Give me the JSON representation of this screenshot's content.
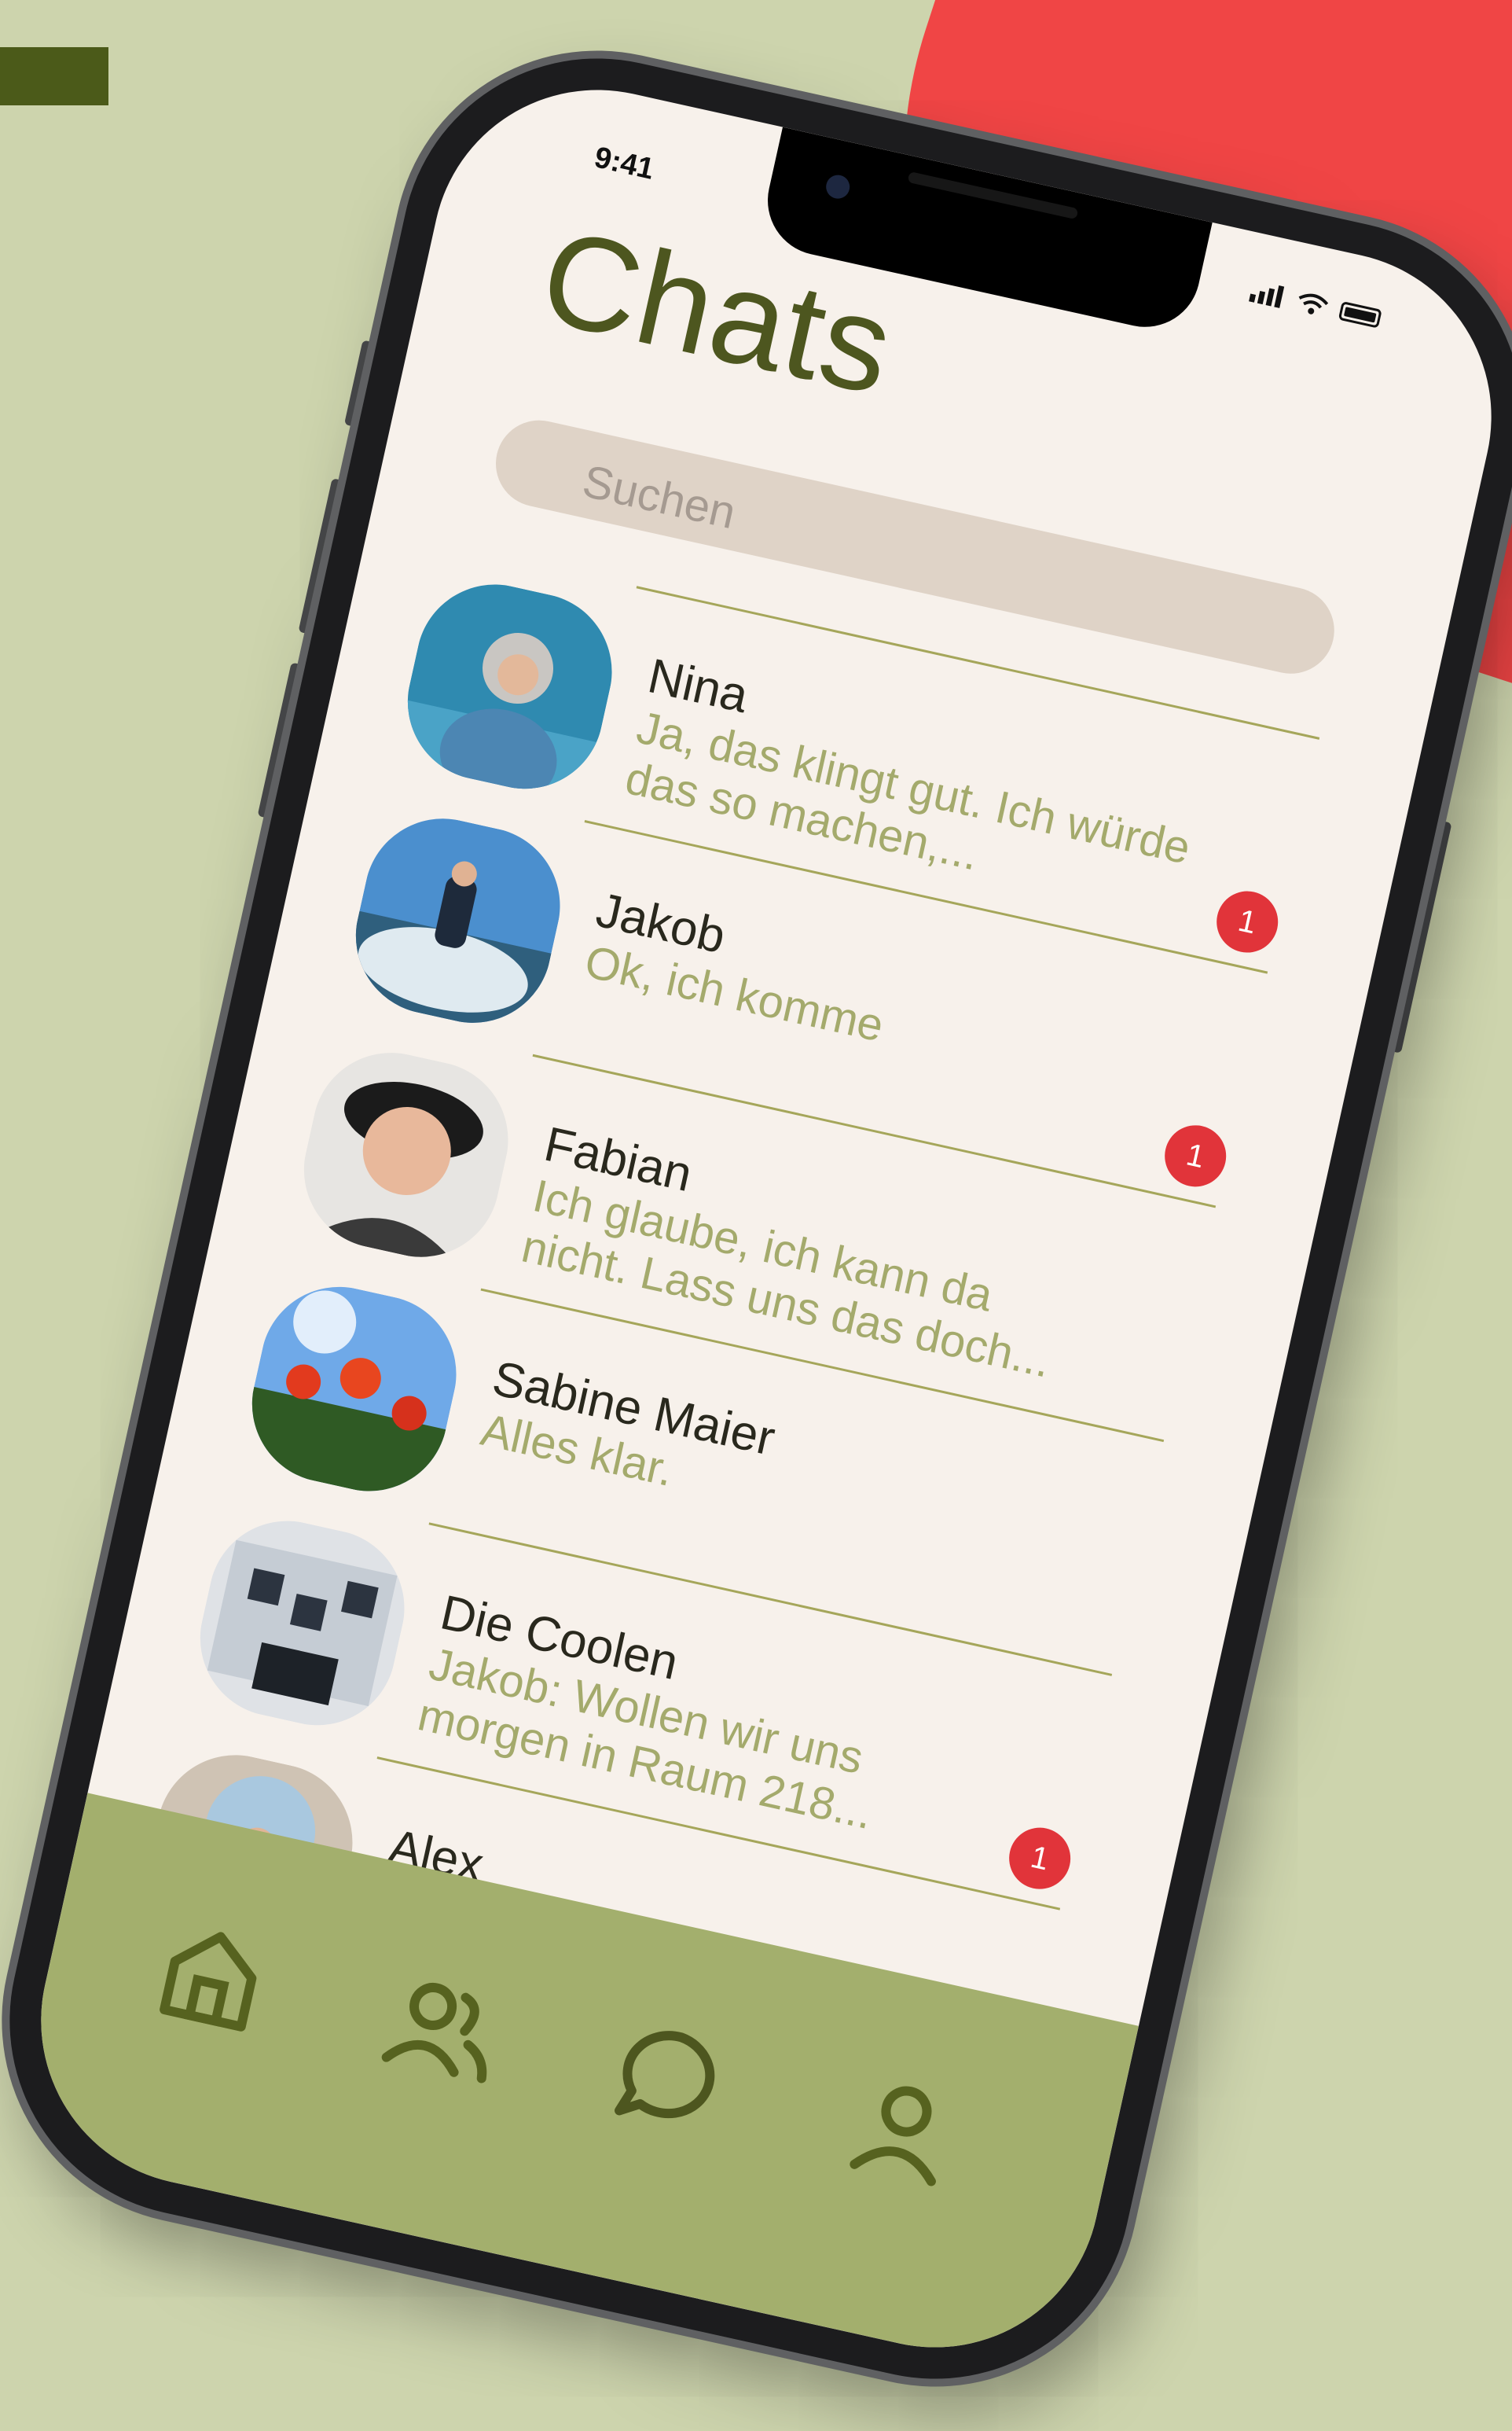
{
  "status_bar": {
    "time": "9:41"
  },
  "header": {
    "title": "Chats"
  },
  "search": {
    "placeholder": "Suchen"
  },
  "chats": [
    {
      "name": "Nina",
      "preview": "Ja, das klingt gut. Ich würde das so machen,...",
      "badge": "1"
    },
    {
      "name": "Jakob",
      "preview": "Ok, ich komme",
      "badge": "1"
    },
    {
      "name": "Fabian",
      "preview": "Ich glaube, ich kann da nicht. Lass uns das doch...",
      "badge": ""
    },
    {
      "name": "Sabine Maier",
      "preview": "Alles klar.",
      "badge": ""
    },
    {
      "name": "Die Coolen",
      "preview": "Jakob: Wollen wir uns morgen in Raum 218...",
      "badge": "1"
    },
    {
      "name": "Alex",
      "preview": ":)",
      "badge": ""
    }
  ],
  "bottom_nav": {
    "items": [
      {
        "icon": "home-icon"
      },
      {
        "icon": "people-icon"
      },
      {
        "icon": "chat-bubble-icon"
      },
      {
        "icon": "profile-icon"
      }
    ]
  },
  "colors": {
    "background": "#cdd4ad",
    "accent_dark": "#4b5a19",
    "red_shape": "#f04545",
    "screen_bg": "#f7f1eb",
    "title": "#4d561f",
    "preview_text": "#a4aa6c",
    "badge": "#e1343a",
    "nav_bar": "#a3af6d"
  }
}
